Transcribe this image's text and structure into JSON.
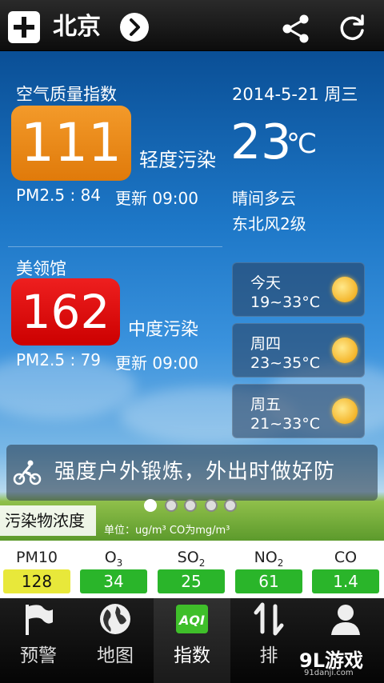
{
  "header": {
    "city": "北京",
    "colors": {
      "bar": "#111111",
      "icon": "#ffffff"
    }
  },
  "city_aqi": {
    "title": "空气质量指数",
    "value": "111",
    "level": "轻度污染",
    "pm25": "PM2.5 : 84",
    "update": "更新 09:00",
    "color": "#e8820f"
  },
  "weather": {
    "date": "2014-5-21 周三",
    "temp": "23",
    "unit": "℃",
    "condition": "晴间多云",
    "wind": "东北风2级"
  },
  "embassy_aqi": {
    "title": "美领馆",
    "value": "162",
    "level": "中度污染",
    "pm25": "PM2.5 : 79",
    "update": "更新 09:00",
    "color": "#dd1010"
  },
  "forecast": [
    {
      "day": "今天",
      "range": "19~33°C",
      "icon": "sun-icon"
    },
    {
      "day": "周四",
      "range": "23~35°C",
      "icon": "sun-icon"
    },
    {
      "day": "周五",
      "range": "21~33°C",
      "icon": "sun-icon"
    }
  ],
  "banner": {
    "message": "强度户外锻炼，外出时做好防",
    "icon": "cyclist-icon",
    "page_count": 5,
    "active_page": 1
  },
  "pollutants": {
    "label": "污染物浓度",
    "unit": "单位：ug/m³ CO为mg/m³",
    "items": [
      {
        "name": "PM10",
        "sub": "",
        "value": "128",
        "color": "#e8e83a"
      },
      {
        "name": "O",
        "sub": "3",
        "value": "34",
        "color": "#2ab52a"
      },
      {
        "name": "SO",
        "sub": "2",
        "value": "25",
        "color": "#2ab52a"
      },
      {
        "name": "NO",
        "sub": "2",
        "value": "61",
        "color": "#2ab52a"
      },
      {
        "name": "CO",
        "sub": "",
        "value": "1.4",
        "color": "#2ab52a"
      }
    ]
  },
  "nav": {
    "items": [
      {
        "label": "预警",
        "icon": "flag-icon"
      },
      {
        "label": "地图",
        "icon": "globe-icon"
      },
      {
        "label": "指数",
        "icon": "aqi-icon",
        "active": true
      },
      {
        "label": "排",
        "icon": "sort-icon"
      },
      {
        "label": "",
        "icon": "user-icon"
      }
    ],
    "aqi_badge": "AQI"
  },
  "watermark": {
    "brand": "9L游戏",
    "site": "91danji.com"
  }
}
